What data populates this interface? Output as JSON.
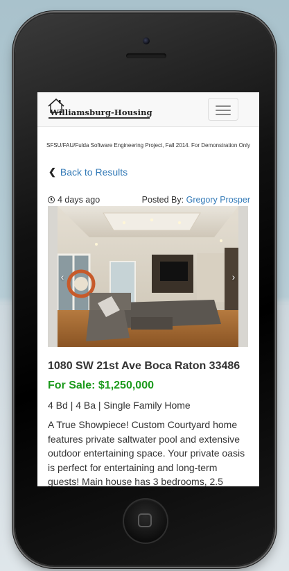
{
  "navbar": {
    "brand": "Williamsburg-Housing",
    "toggle_label": "Toggle navigation"
  },
  "disclaimer": "SFSU/FAU/Fulda Software Engineering Project, Fall 2014. For Demonstration Only",
  "back_link": "Back to Results",
  "listing": {
    "posted_ago": "4 days ago",
    "posted_by_label": "Posted By:",
    "poster": "Gregory Prosper",
    "address": "1080 SW 21st Ave Boca Raton 33486",
    "price": "For Sale: $1,250,000",
    "specs": "4 Bd | 4 Ba | Single Family Home",
    "description": "A True Showpiece! Custom Courtyard home features private saltwater pool and extensive outdoor entertaining space. Your private oasis is perfect for entertaining and long-term guests! Main house has 3 bedrooms, 2.5"
  },
  "carousel": {
    "prev_icon": "chevron-left-icon",
    "next_icon": "chevron-right-icon"
  },
  "colors": {
    "link": "#337ab7",
    "price": "#1c9a1c"
  }
}
